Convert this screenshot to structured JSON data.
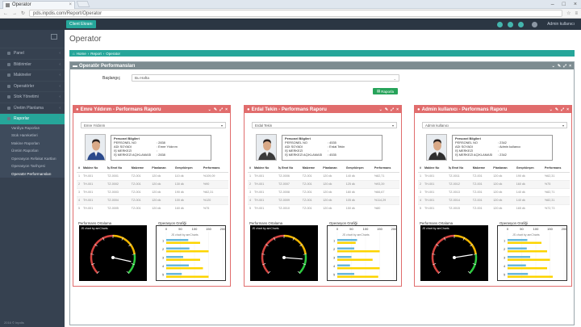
{
  "browser": {
    "tab_title": "Operator",
    "url": "pds.inpdis.com/Report/Operator"
  },
  "topnav": {
    "client_button": "Client Ekranı",
    "user": "Admin kullanıcı"
  },
  "sidebar": {
    "items": [
      {
        "label": "Panel"
      },
      {
        "label": "Bildirimler"
      },
      {
        "label": "Makineler"
      },
      {
        "label": "Operatörler"
      },
      {
        "label": "Stok Yönetimi"
      },
      {
        "label": "Üretim Planlama"
      },
      {
        "label": "Raporlar"
      }
    ],
    "subitems": [
      {
        "label": "Vardiya Raporları"
      },
      {
        "label": "Stok Hareketleri"
      },
      {
        "label": "Makine Raporları"
      },
      {
        "label": "Üretim Raporları"
      },
      {
        "label": "Operasyon Refakat Kartları"
      },
      {
        "label": "Operasyon Tarihçesi"
      },
      {
        "label": "Operatör Performansları"
      }
    ],
    "footer": "2016 © Inpdis"
  },
  "page": {
    "title": "Operator",
    "breadcrumb": [
      "Home",
      "Report",
      "Operator"
    ],
    "portlet_title": "Operatör Performansları",
    "filter_label": "Başlangıç",
    "filter_value": "Bu Hafta",
    "report_button": "Raporla"
  },
  "common": {
    "info_title": "Personel Bilgileri",
    "k_no": "PERSONEL NO",
    "k_name": "ADI SOYADI",
    "k_center": "İŞ MERKEZİ",
    "k_center_desc": "İŞ MERKEZİ AÇIKLAMASI",
    "columns": [
      "#",
      "Makine No",
      "İş Emri No",
      "Malzeme",
      "Planlanan",
      "Gerçekleşen",
      "Performans"
    ],
    "perf_label": "Performans Ortalama",
    "op_label": "Operasyon Grafiği",
    "gauge_note": "JS chart by amCharts",
    "bar_note": "JS chart by amCharts",
    "bar_ticks": [
      "0",
      "50",
      "100",
      "150",
      "200"
    ],
    "bar_rows": [
      "1",
      "2",
      "3",
      "4",
      "5"
    ]
  },
  "cards": [
    {
      "title": "Emre Yıldırım - Performans Raporu",
      "select": "Emre Yıldırım",
      "no": ": 2838",
      "name": ": Emre Yıldırım",
      "center": ":",
      "center_desc": ": 2838",
      "shirt": "#2b4a8c",
      "rows": [
        [
          "1",
          "TH-001",
          "TZ-0001",
          "TZ-001",
          "120 dk",
          "110 dk",
          "%109,09"
        ],
        [
          "2",
          "TH-001",
          "TZ-0002",
          "TZ-001",
          "120 dk",
          "130 dk",
          "%90"
        ],
        [
          "3",
          "TH-001",
          "TZ-0003",
          "TZ-001",
          "120 dk",
          "190 dk",
          "%62,31"
        ],
        [
          "4",
          "TH-001",
          "TZ-0004",
          "TZ-001",
          "120 dk",
          "100 dk",
          "%120"
        ],
        [
          "5",
          "TH-001",
          "TZ-0005",
          "TZ-001",
          "120 dk",
          "160 dk",
          "%75"
        ]
      ],
      "bars": [
        {
          "blue": 78,
          "yellow": 120
        },
        {
          "blue": 82,
          "yellow": 150
        },
        {
          "blue": 60,
          "yellow": 120
        },
        {
          "blue": 80,
          "yellow": 130
        },
        {
          "blue": 55,
          "yellow": 150
        }
      ],
      "gauge": 88
    },
    {
      "title": "Erdal Tekin - Performans Raporu",
      "select": "Erdal Tekin",
      "no": ": 4535",
      "name": ": Erdal Tekin",
      "center": ":",
      "center_desc": ": 4535",
      "shirt": "#3b3b3b",
      "rows": [
        [
          "1",
          "TH-001",
          "TZ-0006",
          "TZ-001",
          "120 dk",
          "140 dk",
          "%82,71"
        ],
        [
          "2",
          "TH-001",
          "TZ-0007",
          "TZ-001",
          "120 dk",
          "125 dk",
          "%93,39"
        ],
        [
          "3",
          "TH-001",
          "TZ-0008",
          "TZ-001",
          "120 dk",
          "180 dk",
          "%66,67"
        ],
        [
          "4",
          "TH-001",
          "TZ-0009",
          "TZ-001",
          "120 dk",
          "105 dk",
          "%114,29"
        ],
        [
          "5",
          "TH-001",
          "TZ-0010",
          "TZ-001",
          "120 dk",
          "150 dk",
          "%80"
        ]
      ],
      "bars": [
        {
          "blue": 70,
          "yellow": 65
        },
        {
          "blue": 60,
          "yellow": 150
        },
        {
          "blue": 50,
          "yellow": 125
        },
        {
          "blue": 45,
          "yellow": 150
        },
        {
          "blue": 60,
          "yellow": 145
        }
      ],
      "gauge": 85
    },
    {
      "title": "Admin kullanıcı - Performans Raporu",
      "select": "Admin kullanıcı",
      "no": ": 2342",
      "name": ": Admin kullanıcı",
      "center": ":",
      "center_desc": ": 2342",
      "shirt": "#2f2f2f",
      "rows": [
        [
          "1",
          "TH-001",
          "TZ-0011",
          "TZ-001",
          "120 dk",
          "190 dk",
          "%62,31"
        ],
        [
          "2",
          "TH-001",
          "TZ-0012",
          "TZ-001",
          "120 dk",
          "160 dk",
          "%75"
        ],
        [
          "3",
          "TH-001",
          "TZ-0013",
          "TZ-001",
          "120 dk",
          "140 dk",
          "%82,71"
        ],
        [
          "4",
          "TH-001",
          "TZ-0014",
          "TZ-001",
          "120 dk",
          "140 dk",
          "%82,31"
        ],
        [
          "5",
          "TH-001",
          "TZ-0015",
          "TZ-001",
          "120 dk",
          "165 dk",
          "%72,73"
        ]
      ],
      "bars": [
        {
          "blue": 70,
          "yellow": 120
        },
        {
          "blue": 68,
          "yellow": 140
        },
        {
          "blue": 80,
          "yellow": 150
        },
        {
          "blue": 65,
          "yellow": 140
        },
        {
          "blue": 72,
          "yellow": 160
        }
      ],
      "gauge": 80
    }
  ],
  "colors": {
    "accent": "#26a69a",
    "card_red": "#e16c6c",
    "bar_blue": "#67b7dc",
    "bar_yellow": "#fdd400"
  }
}
